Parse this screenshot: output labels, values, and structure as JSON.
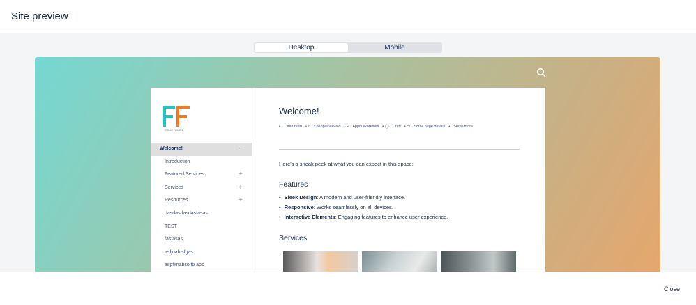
{
  "modal": {
    "title": "Site preview",
    "close_label": "Close"
  },
  "toggle": {
    "options": [
      "Desktop",
      "Mobile"
    ],
    "selected": "Desktop"
  },
  "logo": {
    "letters": "FF",
    "tagline": "TROLIC FUSION"
  },
  "sidebar": {
    "items": [
      {
        "label": "Welcome!",
        "expand": "−",
        "active": true
      },
      {
        "label": "Introduction",
        "expand": ""
      },
      {
        "label": "Featured Services",
        "expand": "+"
      },
      {
        "label": "Services",
        "expand": "+"
      },
      {
        "label": "Resources",
        "expand": "+"
      },
      {
        "label": "dasdasdasdasfasas",
        "expand": ""
      },
      {
        "label": "TEST",
        "expand": ""
      },
      {
        "label": "fasfasas",
        "expand": ""
      },
      {
        "label": "asfjoablsfgas",
        "expand": ""
      },
      {
        "label": "aspfknabsojfb aos",
        "expand": ""
      }
    ]
  },
  "page": {
    "title": "Welcome!",
    "meta": [
      "1 min read",
      "3 people viewed",
      "Apply Workflow",
      "Draft",
      "Scroll page details",
      "Show more"
    ],
    "intro": "Here's a sneak peek at what you can expect in this space:",
    "features_heading": "Features",
    "features": [
      {
        "bold": "Sleek Design",
        "text": ": A modern and user-friendly interface."
      },
      {
        "bold": "Responsive",
        "text": ": Works seamlessly on all devices."
      },
      {
        "bold": "Interactive Elements",
        "text": ": Engaging features to enhance user experience."
      }
    ],
    "services_heading": "Services"
  }
}
